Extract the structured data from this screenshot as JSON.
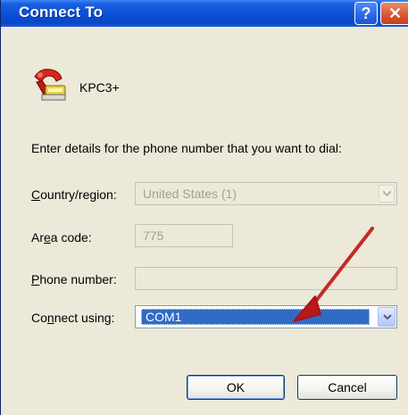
{
  "window": {
    "title": "Connect To"
  },
  "device": {
    "name": "KPC3+"
  },
  "instruction": "Enter details for the phone number that you want to dial:",
  "country": {
    "label_pre": "",
    "label_u": "C",
    "label_post": "ountry/region:",
    "value": "United States (1)"
  },
  "area": {
    "label_pre": "Ar",
    "label_u": "e",
    "label_post": "a code:",
    "value": "775"
  },
  "phone": {
    "label_pre": "",
    "label_u": "P",
    "label_post": "hone number:",
    "value": ""
  },
  "connect": {
    "label_pre": "Co",
    "label_u": "n",
    "label_post": "nect using:",
    "value": "COM1"
  },
  "buttons": {
    "ok": "OK",
    "cancel": "Cancel"
  },
  "icons": {
    "help": "?",
    "close": "✕"
  },
  "colors": {
    "title_bar": "#0a4fd8",
    "selection": "#316ac5",
    "annotation_arrow": "#c81e1e"
  }
}
